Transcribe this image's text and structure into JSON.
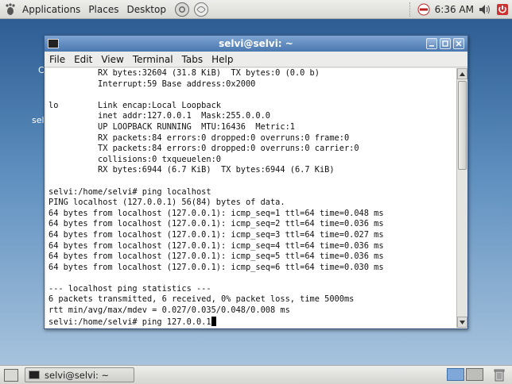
{
  "top_panel": {
    "menus": [
      "Applications",
      "Places",
      "Desktop"
    ],
    "clock": "6:36 AM"
  },
  "desktop": {
    "fragments": [
      "C",
      "sel"
    ]
  },
  "window": {
    "title": "selvi@selvi: ~",
    "menu": [
      "File",
      "Edit",
      "View",
      "Terminal",
      "Tabs",
      "Help"
    ],
    "terminal_lines": [
      "          RX bytes:32604 (31.8 KiB)  TX bytes:0 (0.0 b)",
      "          Interrupt:59 Base address:0x2000",
      "",
      "lo        Link encap:Local Loopback",
      "          inet addr:127.0.0.1  Mask:255.0.0.0",
      "          UP LOOPBACK RUNNING  MTU:16436  Metric:1",
      "          RX packets:84 errors:0 dropped:0 overruns:0 frame:0",
      "          TX packets:84 errors:0 dropped:0 overruns:0 carrier:0",
      "          collisions:0 txqueuelen:0",
      "          RX bytes:6944 (6.7 KiB)  TX bytes:6944 (6.7 KiB)",
      "",
      "selvi:/home/selvi# ping localhost",
      "PING localhost (127.0.0.1) 56(84) bytes of data.",
      "64 bytes from localhost (127.0.0.1): icmp_seq=1 ttl=64 time=0.048 ms",
      "64 bytes from localhost (127.0.0.1): icmp_seq=2 ttl=64 time=0.036 ms",
      "64 bytes from localhost (127.0.0.1): icmp_seq=3 ttl=64 time=0.027 ms",
      "64 bytes from localhost (127.0.0.1): icmp_seq=4 ttl=64 time=0.036 ms",
      "64 bytes from localhost (127.0.0.1): icmp_seq=5 ttl=64 time=0.036 ms",
      "64 bytes from localhost (127.0.0.1): icmp_seq=6 ttl=64 time=0.030 ms",
      "",
      "--- localhost ping statistics ---",
      "6 packets transmitted, 6 received, 0% packet loss, time 5000ms",
      "rtt min/avg/max/mdev = 0.027/0.035/0.048/0.008 ms"
    ],
    "prompt_line": "selvi:/home/selvi# ping 127.0.0.1"
  },
  "bottom_panel": {
    "task_label": "selvi@selvi: ~"
  },
  "colors": {
    "titlebar": "#4a78b0",
    "desktop": "#4d7fae",
    "terminal_bg": "#ffffff",
    "terminal_fg": "#111111"
  },
  "icons": [
    "gnome-foot-icon",
    "help-icon",
    "network-icon",
    "no-entry-icon",
    "volume-icon",
    "logout-icon",
    "terminal-icon",
    "trash-icon"
  ]
}
